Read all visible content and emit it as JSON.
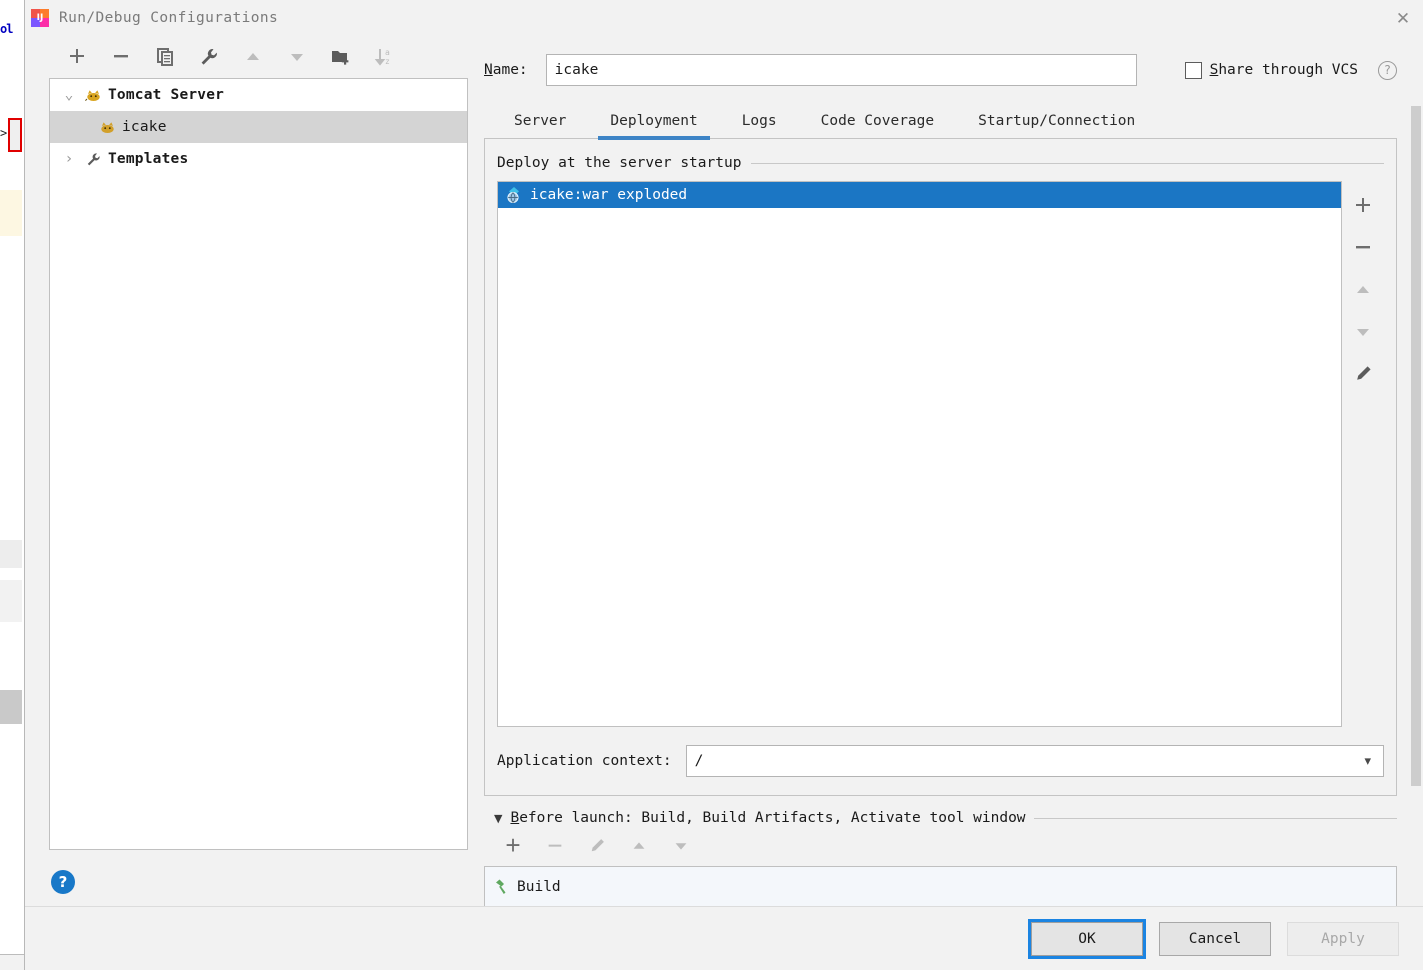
{
  "window": {
    "title": "Run/Debug Configurations",
    "app_icon": "intellij-idea-icon",
    "close_label": "✕"
  },
  "left_panel": {
    "toolbar": [
      {
        "name": "add-configuration-button",
        "icon": "plus-icon",
        "label": "Add New Configuration",
        "enabled": true
      },
      {
        "name": "remove-configuration-button",
        "icon": "minus-icon",
        "label": "Remove Configuration",
        "enabled": true
      },
      {
        "name": "copy-configuration-button",
        "icon": "copy-icon",
        "label": "Copy Configuration",
        "enabled": true
      },
      {
        "name": "edit-templates-button",
        "icon": "wrench-icon",
        "label": "Edit Templates",
        "enabled": true
      },
      {
        "name": "move-up-button",
        "icon": "arrow-up-icon",
        "label": "Move Up",
        "enabled": false
      },
      {
        "name": "move-down-button",
        "icon": "arrow-down-icon",
        "label": "Move Down",
        "enabled": false
      },
      {
        "name": "new-folder-button",
        "icon": "folder-add-icon",
        "label": "Create New Folder",
        "enabled": true
      },
      {
        "name": "sort-configurations-button",
        "icon": "sort-alpha-icon",
        "label": "Sort Configurations",
        "enabled": false
      }
    ],
    "tree": [
      {
        "label": "Tomcat Server",
        "icon": "tomcat-icon",
        "twisty": "⌄",
        "bold": true,
        "indent": false,
        "selected": false
      },
      {
        "label": "icake",
        "icon": "tomcat-icon",
        "twisty": "",
        "bold": false,
        "indent": true,
        "selected": true
      },
      {
        "label": "Templates",
        "icon": "wrench-icon",
        "twisty": "›",
        "bold": true,
        "indent": false,
        "selected": false
      }
    ],
    "help_button_label": "?"
  },
  "name_field": {
    "label_prefix": "N",
    "label_rest": "ame:",
    "value": "icake",
    "placeholder": ""
  },
  "share": {
    "label_prefix": "S",
    "label_rest": "hare through VCS",
    "checked": false,
    "help_label": "?"
  },
  "tabs": [
    {
      "label": "Server",
      "active": false
    },
    {
      "label": "Deployment",
      "active": true
    },
    {
      "label": "Logs",
      "active": false
    },
    {
      "label": "Code Coverage",
      "active": false
    },
    {
      "label": "Startup/Connection",
      "active": false
    }
  ],
  "deployment": {
    "section_title": "Deploy at the server startup",
    "items": [
      {
        "label": "icake:war exploded",
        "icon": "artifact-icon",
        "selected": true
      }
    ],
    "side_toolbar": [
      {
        "name": "add-artifact-button",
        "icon": "plus-icon",
        "enabled": true
      },
      {
        "name": "remove-artifact-button",
        "icon": "minus-icon",
        "enabled": true
      },
      {
        "name": "move-artifact-up-button",
        "icon": "arrow-up-icon",
        "enabled": false
      },
      {
        "name": "move-artifact-down-button",
        "icon": "arrow-down-icon",
        "enabled": false
      },
      {
        "name": "edit-artifact-button",
        "icon": "pencil-icon",
        "enabled": true
      }
    ],
    "application_context": {
      "label": "Application context:",
      "value": "/",
      "dropdown_icon": "chevron-down-icon"
    }
  },
  "before_launch": {
    "triangle": "▼",
    "title_prefix": "B",
    "title_rest": "efore launch: Build, Build Artifacts, Activate tool window",
    "toolbar": [
      {
        "name": "add-task-button",
        "icon": "plus-icon",
        "enabled": true
      },
      {
        "name": "remove-task-button",
        "icon": "minus-icon",
        "enabled": false
      },
      {
        "name": "edit-task-button",
        "icon": "pencil-icon",
        "enabled": false
      },
      {
        "name": "move-task-up-button",
        "icon": "arrow-up-icon",
        "enabled": false
      },
      {
        "name": "move-task-down-button",
        "icon": "arrow-down-icon",
        "enabled": false
      }
    ],
    "tasks": [
      {
        "label": "Build",
        "icon": "hammer-icon"
      }
    ]
  },
  "footer": {
    "ok_label": "OK",
    "cancel_label": "Cancel",
    "apply_label": "Apply",
    "apply_enabled": false
  },
  "colors": {
    "selection_blue": "#1b76c4",
    "tab_underline": "#3d84c6",
    "focus_ring": "#1b84e2",
    "help_blue": "#1878c8",
    "tomcat_gold": "#d9a520",
    "hammer_green": "#5fa860",
    "dialog_bg": "#f2f2f2"
  }
}
